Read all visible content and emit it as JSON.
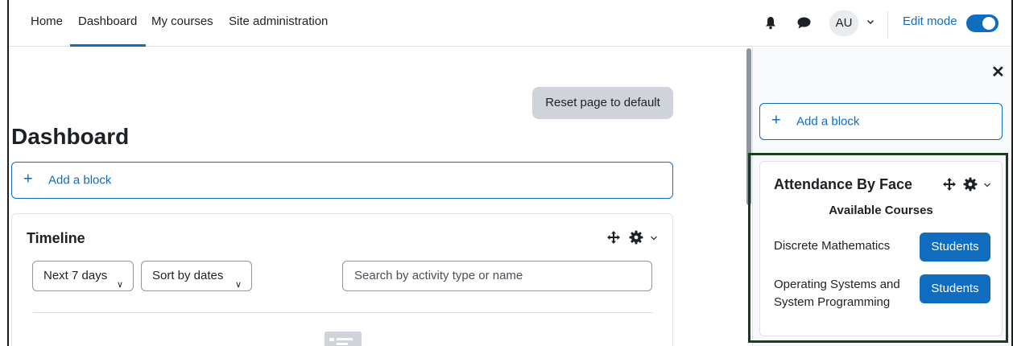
{
  "navbar": {
    "links": [
      "Home",
      "Dashboard",
      "My courses",
      "Site administration"
    ],
    "avatar_initials": "AU",
    "edit_mode_label": "Edit mode",
    "edit_mode_on": true
  },
  "main": {
    "reset_button": "Reset page to default",
    "page_title": "Dashboard",
    "add_block": "Add a block",
    "timeline": {
      "title": "Timeline",
      "filter_days": "Next 7 days",
      "sort": "Sort by dates",
      "search_placeholder": "Search by activity type or name"
    }
  },
  "drawer": {
    "add_block": "Add a block",
    "attendance": {
      "title": "Attendance By Face",
      "subtitle": "Available Courses",
      "courses": [
        {
          "name_line1": "Discrete Mathematics",
          "name_line2": "",
          "button": "Students"
        },
        {
          "name_line1": "Operating Systems and",
          "name_line2": "System Programming",
          "button": "Students"
        }
      ]
    }
  },
  "colors": {
    "primary": "#0f6cbf",
    "highlight_outline": "#173f1f",
    "secondary_button": "#ced4da"
  }
}
